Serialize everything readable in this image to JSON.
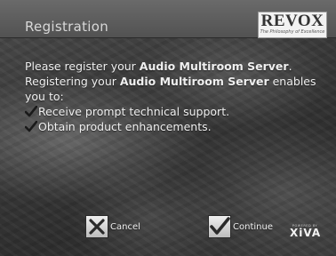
{
  "header": {
    "title": "Registration",
    "logo_text": "REVOX",
    "logo_tagline": "The Philosophy of Excellence"
  },
  "content": {
    "line1_pre": "Please register your ",
    "line1_bold": "Audio Multiroom Server",
    "line1_post": ".",
    "line2_pre": "Registering your ",
    "line2_bold": "Audio Multiroom Server",
    "line2_post": " enables",
    "line3": "you to:",
    "bullets": [
      "Receive prompt technical support.",
      "Obtain product enhancements."
    ]
  },
  "buttons": {
    "cancel_label": "Cancel",
    "continue_label": "Continue"
  },
  "footer": {
    "powered_by": "POWERED BY",
    "brand": "XiVA"
  },
  "icons": {
    "check": "check-icon",
    "cancel": "x-icon",
    "continue": "checkmark-icon"
  }
}
